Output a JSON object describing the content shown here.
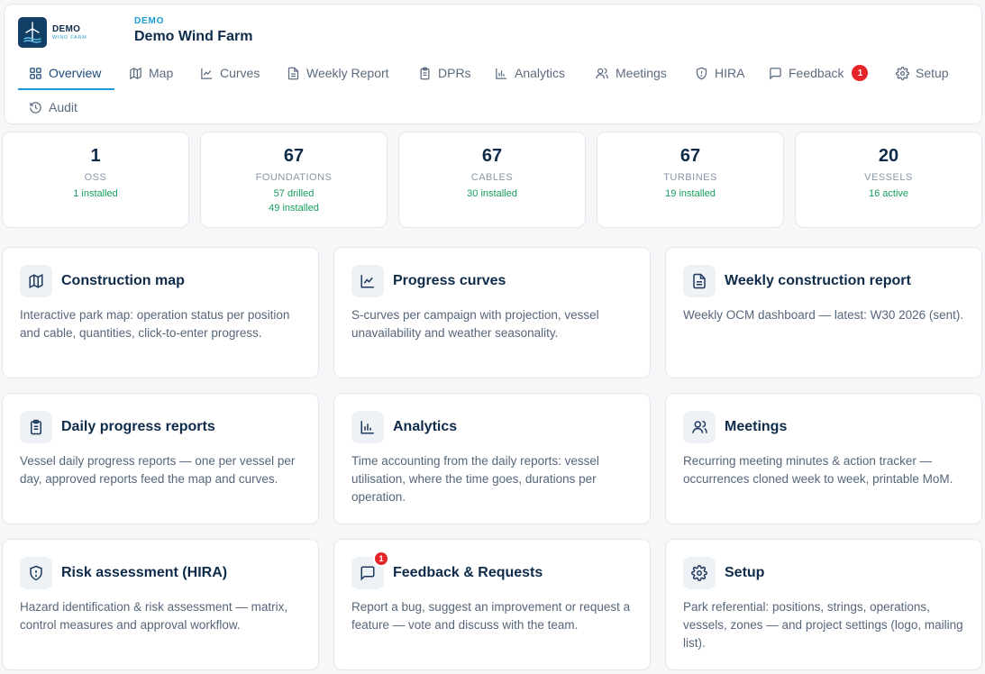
{
  "header": {
    "logo_main": "DEMO",
    "logo_sub": "WIND FARM",
    "project_code": "DEMO",
    "project_name": "Demo Wind Farm"
  },
  "tabs": [
    {
      "label": "Overview",
      "icon": "grid-icon",
      "active": true
    },
    {
      "label": "Map",
      "icon": "map-icon"
    },
    {
      "label": "Curves",
      "icon": "chart-line-icon"
    },
    {
      "label": "Weekly Report",
      "icon": "document-icon"
    },
    {
      "label": "DPRs",
      "icon": "clipboard-icon"
    },
    {
      "label": "Analytics",
      "icon": "bar-chart-icon"
    },
    {
      "label": "Meetings",
      "icon": "users-icon"
    },
    {
      "label": "HIRA",
      "icon": "shield-icon"
    },
    {
      "label": "Feedback",
      "icon": "message-icon",
      "badge": "1"
    },
    {
      "label": "Setup",
      "icon": "gear-icon"
    },
    {
      "label": "Audit",
      "icon": "history-icon"
    }
  ],
  "stats": [
    {
      "value": "1",
      "label": "OSS",
      "sub": "1 installed"
    },
    {
      "value": "67",
      "label": "FOUNDATIONS",
      "sub": "57 drilled",
      "sub2": "49 installed"
    },
    {
      "value": "67",
      "label": "CABLES",
      "sub": "30 installed"
    },
    {
      "value": "67",
      "label": "TURBINES",
      "sub": "19 installed"
    },
    {
      "value": "20",
      "label": "VESSELS",
      "sub": "16 active"
    }
  ],
  "cards": [
    {
      "title": "Construction map",
      "icon": "map-icon",
      "desc": "Interactive park map: operation status per position and cable, quantities, click-to-enter progress."
    },
    {
      "title": "Progress curves",
      "icon": "chart-line-icon",
      "desc": "S-curves per campaign with projection, vessel unavailability and weather seasonality."
    },
    {
      "title": "Weekly construction report",
      "icon": "document-icon",
      "desc": "Weekly OCM dashboard — latest: W30 2026 (sent)."
    },
    {
      "title": "Daily progress reports",
      "icon": "clipboard-icon",
      "desc": "Vessel daily progress reports — one per vessel per day, approved reports feed the map and curves."
    },
    {
      "title": "Analytics",
      "icon": "bar-chart-icon",
      "desc": "Time accounting from the daily reports: vessel utilisation, where the time goes, durations per operation."
    },
    {
      "title": "Meetings",
      "icon": "users-icon",
      "desc": "Recurring meeting minutes & action tracker — occurrences cloned week to week, printable MoM."
    },
    {
      "title": "Risk assessment (HIRA)",
      "icon": "shield-icon",
      "desc": "Hazard identification & risk assessment — matrix, control measures and approval workflow."
    },
    {
      "title": "Feedback & Requests",
      "icon": "message-icon",
      "badge": "1",
      "desc": "Report a bug, suggest an improvement or request a feature — vote and discuss with the team."
    },
    {
      "title": "Setup",
      "icon": "gear-icon",
      "desc": "Park referential: positions, strings, operations, vessels, zones — and project settings (logo, mailing list)."
    }
  ],
  "colors": {
    "accent": "#1a9bd7",
    "navy": "#0f2b4a",
    "success": "#169c5c",
    "badge": "#e5252a"
  }
}
